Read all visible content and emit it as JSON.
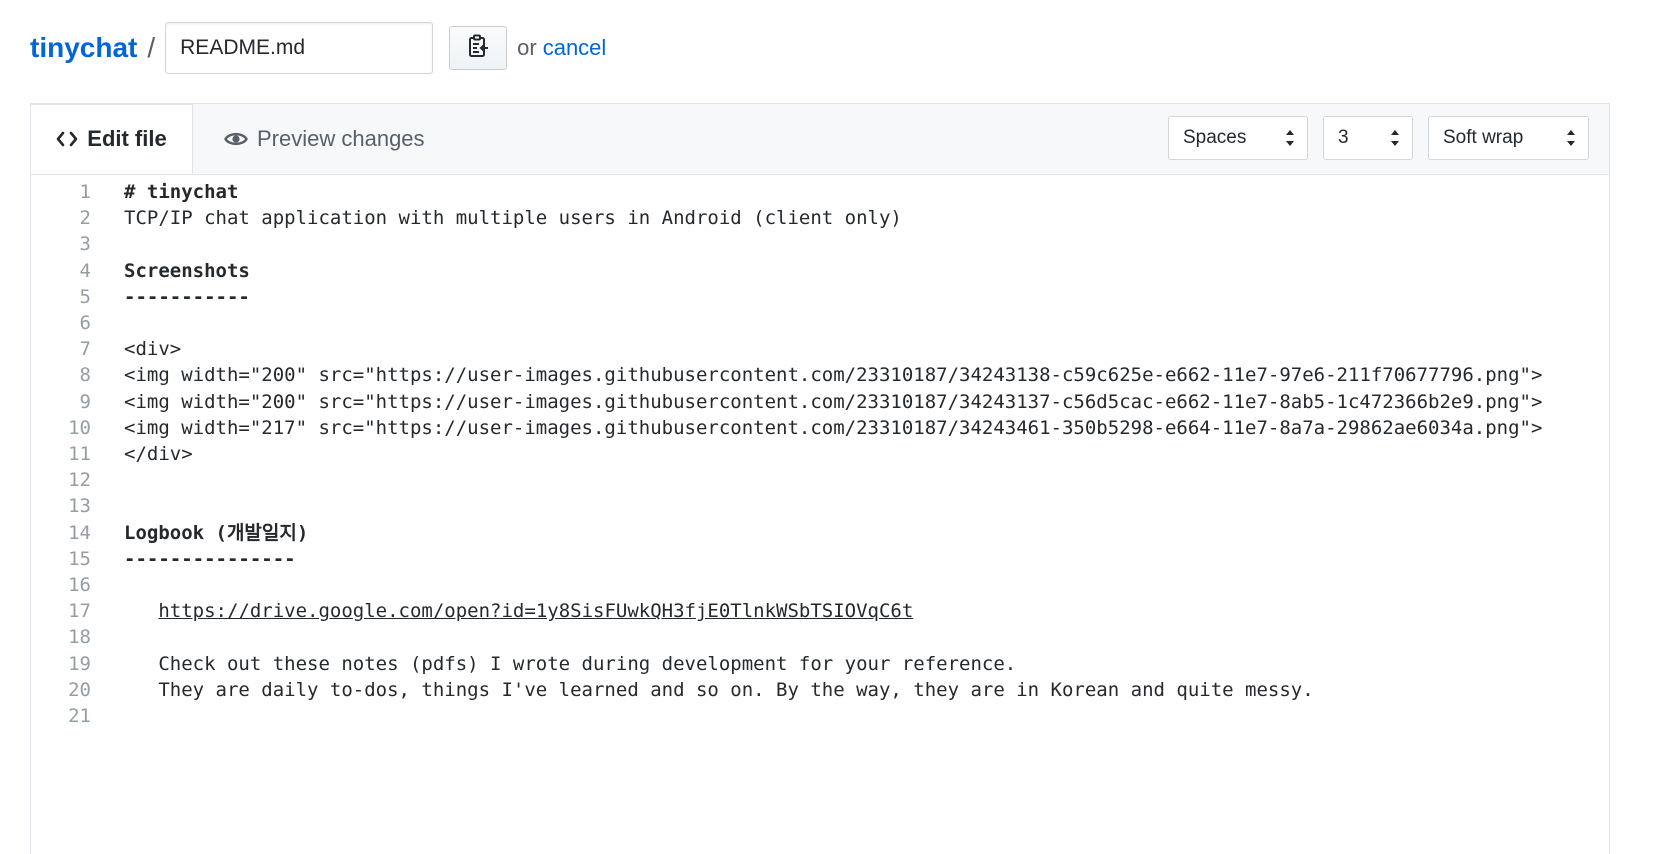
{
  "header": {
    "repo_name": "tinychat",
    "separator": "/",
    "filename_value": "README.md",
    "clipboard_icon": "clipboard-icon",
    "or_text": "or",
    "cancel_label": "cancel"
  },
  "tabs": {
    "edit_label": "Edit file",
    "edit_icon": "code-icon",
    "preview_label": "Preview changes",
    "preview_icon": "eye-icon"
  },
  "options": {
    "indent_mode": "Spaces",
    "indent_size": "3",
    "wrap_mode": "Soft wrap"
  },
  "code": {
    "lines": [
      {
        "n": "1",
        "text": "# tinychat",
        "style": "bold"
      },
      {
        "n": "2",
        "text": "TCP/IP chat application with multiple users in Android (client only)",
        "style": "normal"
      },
      {
        "n": "3",
        "text": "",
        "style": "normal"
      },
      {
        "n": "4",
        "text": "Screenshots",
        "style": "bold"
      },
      {
        "n": "5",
        "text": "-----------",
        "style": "bold"
      },
      {
        "n": "6",
        "text": "",
        "style": "normal"
      },
      {
        "n": "7",
        "text": "<div>",
        "style": "normal"
      },
      {
        "n": "8",
        "text": "<img width=\"200\" src=\"https://user-images.githubusercontent.com/23310187/34243138-c59c625e-e662-11e7-97e6-211f70677796.png\">",
        "style": "normal"
      },
      {
        "n": "9",
        "text": "<img width=\"200\" src=\"https://user-images.githubusercontent.com/23310187/34243137-c56d5cac-e662-11e7-8ab5-1c472366b2e9.png\">",
        "style": "normal"
      },
      {
        "n": "10",
        "text": "<img width=\"217\" src=\"https://user-images.githubusercontent.com/23310187/34243461-350b5298-e664-11e7-8a7a-29862ae6034a.png\">",
        "style": "normal"
      },
      {
        "n": "11",
        "text": "</div>",
        "style": "normal"
      },
      {
        "n": "12",
        "text": "",
        "style": "normal"
      },
      {
        "n": "13",
        "text": "",
        "style": "normal"
      },
      {
        "n": "14",
        "text": "Logbook (개발일지)",
        "style": "bold"
      },
      {
        "n": "15",
        "text": "---------------",
        "style": "bold"
      },
      {
        "n": "16",
        "text": "",
        "style": "normal"
      },
      {
        "n": "17",
        "text": "   https://drive.google.com/open?id=1y8SisFUwkQH3fjE0TlnkWSbTSIOVqC6t",
        "style": "link"
      },
      {
        "n": "18",
        "text": "",
        "style": "normal"
      },
      {
        "n": "19",
        "text": "   Check out these notes (pdfs) I wrote during development for your reference.",
        "style": "normal"
      },
      {
        "n": "20",
        "text": "   They are daily to-dos, things I've learned and so on. By the way, they are in Korean and quite messy.",
        "style": "normal"
      },
      {
        "n": "21",
        "text": "",
        "style": "normal"
      }
    ]
  }
}
